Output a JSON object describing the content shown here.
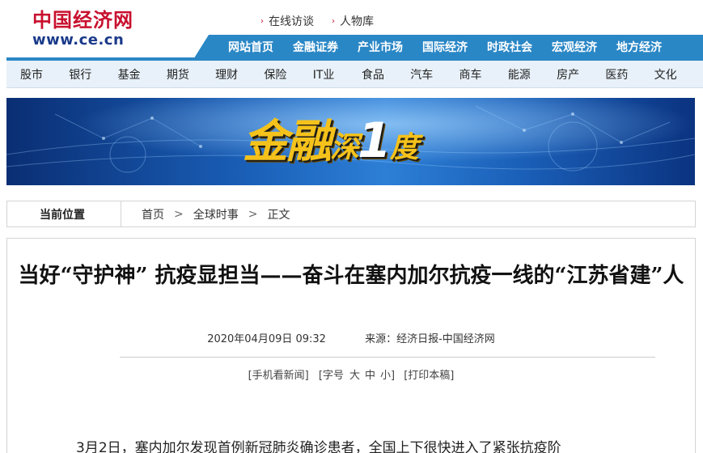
{
  "header": {
    "logo_cn": "中国经济网",
    "logo_url": "www.ce.cn",
    "top_links": [
      "在线访谈",
      "人物库"
    ]
  },
  "main_nav": [
    "网站首页",
    "金融证券",
    "产业市场",
    "国际经济",
    "时政社会",
    "宏观经济",
    "地方经济"
  ],
  "sub_nav": [
    "股市",
    "银行",
    "基金",
    "期货",
    "理财",
    "保险",
    "IT业",
    "食品",
    "汽车",
    "商车",
    "能源",
    "房产",
    "医药",
    "文化"
  ],
  "banner": {
    "part1": "金融",
    "part2": "深",
    "part3": "1",
    "part4": "度"
  },
  "breadcrumb": {
    "label": "当前位置",
    "items": [
      "首页",
      "全球时事",
      "正文"
    ]
  },
  "article": {
    "title": "当好“守护神” 抗疫显担当——奋斗在塞内加尔抗疫一线的“江苏省建”人",
    "datetime": "2020年04月09日 09:32",
    "source": "来源：经济日报-中国经济网",
    "tools": {
      "mobile": "[手机看新闻]",
      "font_prefix": "[字号",
      "font_large": "大",
      "font_medium": "中",
      "font_small": "小]",
      "print": "[打印本稿]"
    },
    "first_line": "3月2日，塞内加尔发现首例新冠肺炎确诊患者，全国上下很快进入了紧张抗疫阶"
  },
  "colors": {
    "brand_red": "#c8102e",
    "nav_blue": "#2a87c6",
    "subnav_bg": "#e8f1f9",
    "banner_gold": "#f5c21b"
  }
}
